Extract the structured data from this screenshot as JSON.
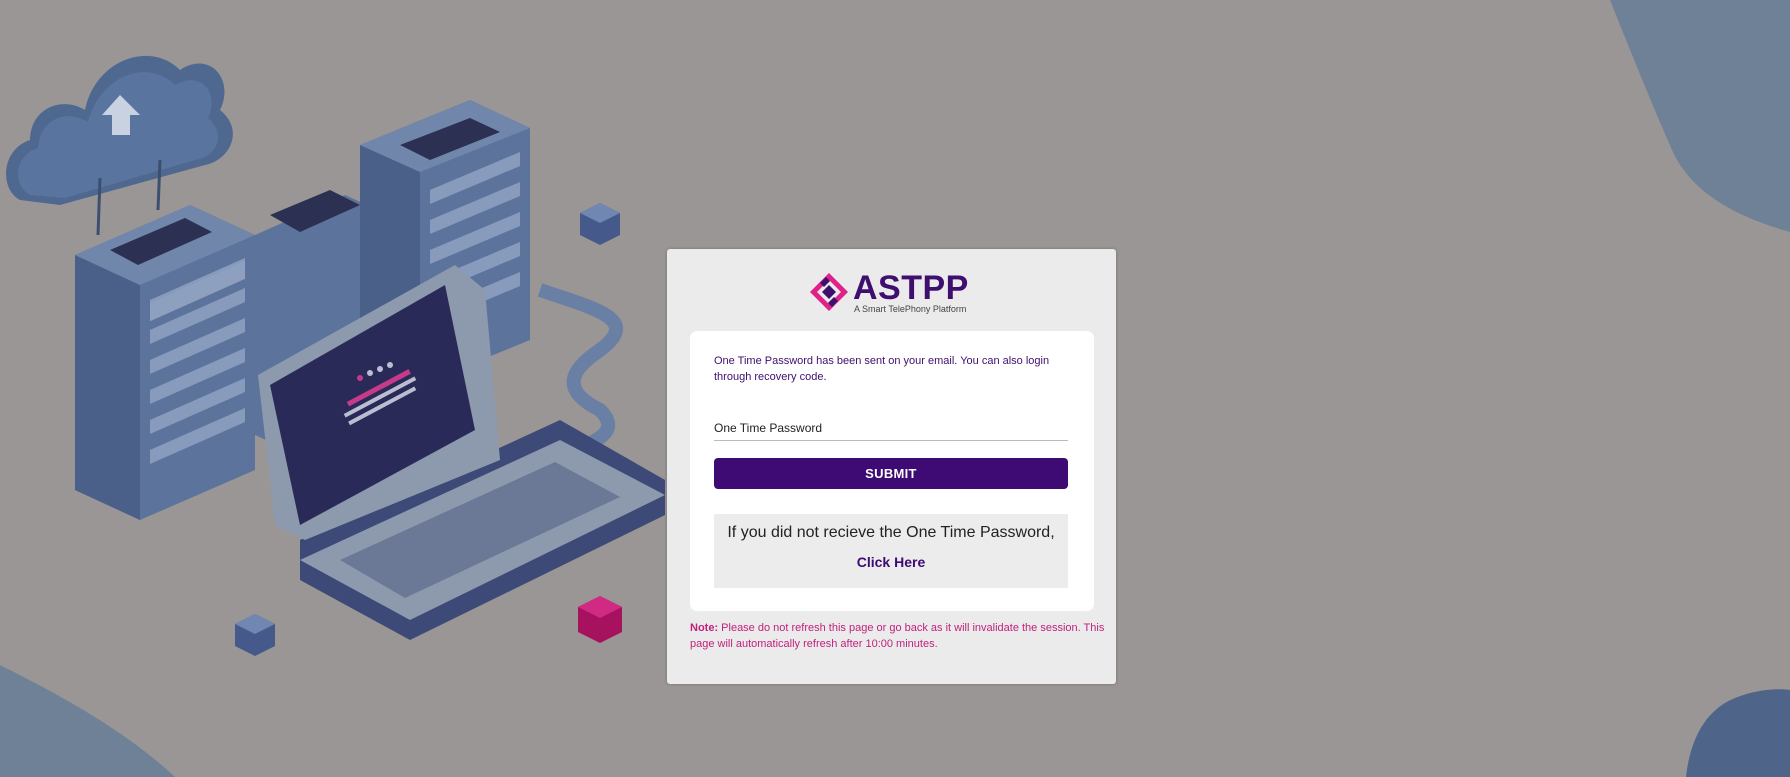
{
  "brand": {
    "name": "ASTPP",
    "tagline": "A Smart TelePhony Platform"
  },
  "otp": {
    "info_text": "One Time Password has been sent on your email. You can also login through recovery code.",
    "placeholder": "One Time Password",
    "submit_label": "SUBMIT",
    "resend_text": "If you did not recieve the One Time Password,",
    "resend_link": "Click Here"
  },
  "note": {
    "label": "Note:",
    "text": " Please do not refresh this page or go back as it will invalidate the session. This page will automatically refresh after 10:00 minutes."
  },
  "colors": {
    "background": "#9a9695",
    "brand_purple": "#3e0a73",
    "brand_pink": "#e0218a",
    "note_pink": "#c0227e",
    "accent_blue": "#5b7394"
  },
  "icons": {
    "logo_mark": "astpp-diamond-logo-icon",
    "illustration": "cloud-servers-laptop-illustration"
  }
}
